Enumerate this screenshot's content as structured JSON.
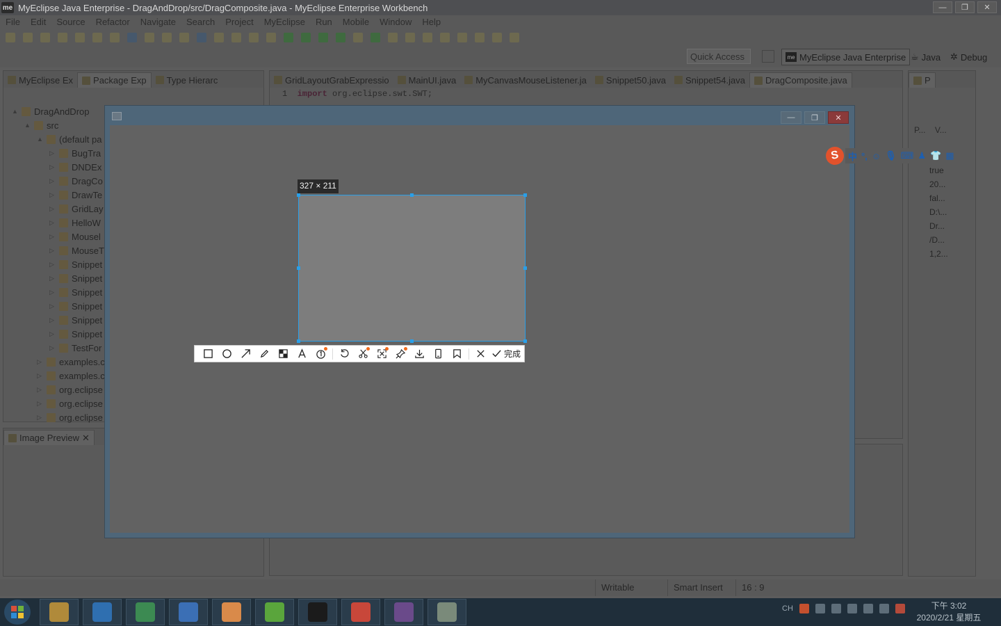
{
  "window": {
    "title": "MyEclipse Java Enterprise - DragAndDrop/src/DragComposite.java - MyEclipse Enterprise Workbench",
    "logo": "me"
  },
  "menu": [
    "File",
    "Edit",
    "Source",
    "Refactor",
    "Navigate",
    "Search",
    "Project",
    "MyEclipse",
    "Run",
    "Mobile",
    "Window",
    "Help"
  ],
  "quick_access": "Quick Access",
  "perspectives": {
    "active": "MyEclipse Java Enterprise",
    "java": "Java",
    "debug": "Debug"
  },
  "left_tabs": [
    "MyEclipse Ex",
    "Package Exp",
    "Type Hierarc"
  ],
  "tree": [
    {
      "label": "DragAndDrop",
      "indent": 0,
      "arrow": "▲"
    },
    {
      "label": "src",
      "indent": 1,
      "arrow": "▲"
    },
    {
      "label": "(default pa",
      "indent": 2,
      "arrow": "▲"
    },
    {
      "label": "BugTra",
      "indent": 3,
      "arrow": "▷"
    },
    {
      "label": "DNDEx",
      "indent": 3,
      "arrow": "▷"
    },
    {
      "label": "DragCo",
      "indent": 3,
      "arrow": "▷"
    },
    {
      "label": "DrawTe",
      "indent": 3,
      "arrow": "▷"
    },
    {
      "label": "GridLay",
      "indent": 3,
      "arrow": "▷"
    },
    {
      "label": "HelloW",
      "indent": 3,
      "arrow": "▷"
    },
    {
      "label": "Mousel",
      "indent": 3,
      "arrow": "▷"
    },
    {
      "label": "MouseT",
      "indent": 3,
      "arrow": "▷"
    },
    {
      "label": "Snippet",
      "indent": 3,
      "arrow": "▷"
    },
    {
      "label": "Snippet",
      "indent": 3,
      "arrow": "▷"
    },
    {
      "label": "Snippet",
      "indent": 3,
      "arrow": "▷"
    },
    {
      "label": "Snippet",
      "indent": 3,
      "arrow": "▷"
    },
    {
      "label": "Snippet",
      "indent": 3,
      "arrow": "▷"
    },
    {
      "label": "Snippet",
      "indent": 3,
      "arrow": "▷"
    },
    {
      "label": "TestFor",
      "indent": 3,
      "arrow": "▷"
    },
    {
      "label": "examples.c",
      "indent": 2,
      "arrow": "▷"
    },
    {
      "label": "examples.c",
      "indent": 2,
      "arrow": "▷"
    },
    {
      "label": "org.eclipse",
      "indent": 2,
      "arrow": "▷"
    },
    {
      "label": "org.eclipse",
      "indent": 2,
      "arrow": "▷"
    },
    {
      "label": "org.eclipse",
      "indent": 2,
      "arrow": "▷"
    }
  ],
  "image_preview_tab": "Image Preview",
  "editor_tabs": [
    "GridLayoutGrabExpressio",
    "MainUI.java",
    "MyCanvasMouseListener.ja",
    "Snippet50.java",
    "Snippet54.java",
    "DragComposite.java"
  ],
  "code": {
    "line_no": "1",
    "keyword": "import",
    "rest": " org.eclipse.swt.SWT;"
  },
  "right_panel": {
    "tab": "P",
    "col1": "P...",
    "col2": "V...",
    "values": [
      "true",
      "20...",
      "fal...",
      "D:\\...",
      "Dr...",
      "/D...",
      "1,2..."
    ]
  },
  "status": {
    "writable": "Writable",
    "insert": "Smart Insert",
    "position": "16 : 9"
  },
  "capture": {
    "size_label": "327 × 211",
    "done_label": "完成"
  },
  "ime": {
    "logo": "S",
    "mode": "中"
  },
  "taskbar": {
    "tray_lang": "CH",
    "time": "下午 3:02",
    "date": "2020/2/21 星期五",
    "apps": [
      {
        "name": "file-explorer",
        "color": "#b08a3a"
      },
      {
        "name": "outlook",
        "color": "#2f6fb0"
      },
      {
        "name": "s-app",
        "color": "#3c8a52"
      },
      {
        "name": "sogou",
        "color": "#3b6fb5"
      },
      {
        "name": "qq-pet",
        "color": "#d98a4a"
      },
      {
        "name": "wechat",
        "color": "#5aa53c"
      },
      {
        "name": "myeclipse",
        "color": "#1b1b1b"
      },
      {
        "name": "chrome",
        "color": "#c8473a"
      },
      {
        "name": "cat-app",
        "color": "#6a4a8a"
      },
      {
        "name": "media",
        "color": "#7a8a7a"
      }
    ]
  }
}
